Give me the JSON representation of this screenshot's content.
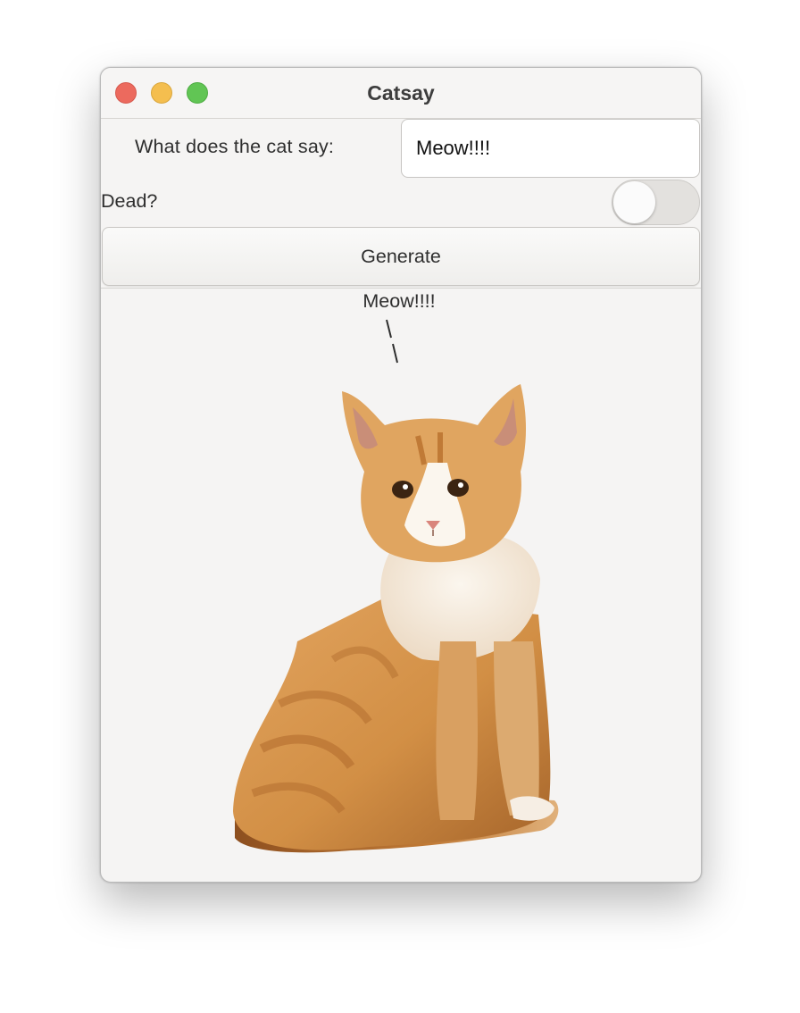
{
  "window": {
    "title": "Catsay"
  },
  "form": {
    "prompt_label": "What does the cat say:",
    "say_value": "Meow!!!!",
    "dead_label": "Dead?",
    "dead_on": false,
    "generate_label": "Generate"
  },
  "output": {
    "speech": "Meow!!!!",
    "image": "orange-tabby-kitten-sitting"
  },
  "colors": {
    "close": "#ec6a5e",
    "minimize": "#f4be4f",
    "maximize": "#61c554",
    "window_bg": "#f5f4f3"
  }
}
